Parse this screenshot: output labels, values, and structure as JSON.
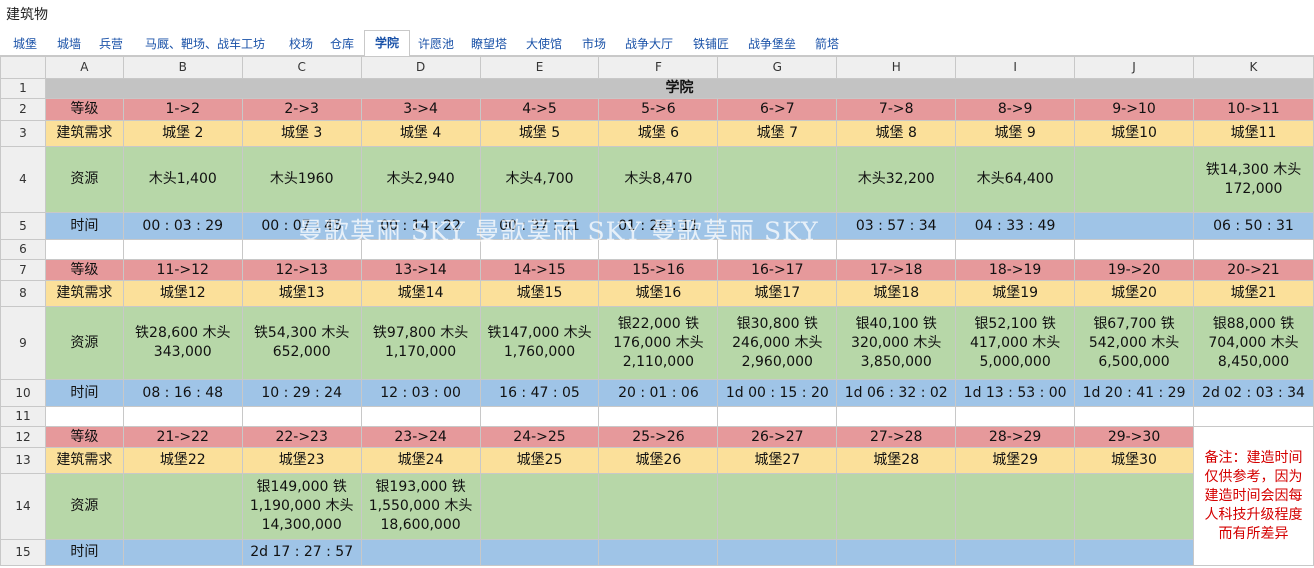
{
  "window": {
    "title": "建筑物"
  },
  "tabs": [
    {
      "label": "城堡"
    },
    {
      "label": "城墙"
    },
    {
      "label": "兵营"
    },
    {
      "label": "马厩、靶场、战车工坊"
    },
    {
      "label": "校场"
    },
    {
      "label": "仓库"
    },
    {
      "label": "学院",
      "active": true
    },
    {
      "label": "许愿池"
    },
    {
      "label": "瞭望塔"
    },
    {
      "label": "大使馆"
    },
    {
      "label": "市场"
    },
    {
      "label": "战争大厅"
    },
    {
      "label": "铁铺匠"
    },
    {
      "label": "战争堡垒"
    },
    {
      "label": "箭塔"
    }
  ],
  "columns": [
    "A",
    "B",
    "C",
    "D",
    "E",
    "F",
    "G",
    "H",
    "I",
    "J",
    "K"
  ],
  "row_numbers": [
    "1",
    "2",
    "3",
    "4",
    "5",
    "6",
    "7",
    "8",
    "9",
    "10",
    "11",
    "12",
    "13",
    "14",
    "15"
  ],
  "section_title": "学院",
  "labels": {
    "level": "等级",
    "requirement": "建筑需求",
    "resource": "资源",
    "time": "时间"
  },
  "block1": {
    "levels": [
      "1->2",
      "2->3",
      "3->4",
      "4->5",
      "5->6",
      "6->7",
      "7->8",
      "8->9",
      "9->10",
      "10->11"
    ],
    "requirements": [
      "城堡 2",
      "城堡 3",
      "城堡 4",
      "城堡 5",
      "城堡 6",
      "城堡 7",
      "城堡 8",
      "城堡 9",
      "城堡10",
      "城堡11"
    ],
    "resources": [
      "木头1,400",
      "木头1960",
      "木头2,940",
      "木头4,700",
      "木头8,470",
      "",
      "木头32,200",
      "木头64,400",
      "",
      "铁14,300 木头\n172,000"
    ],
    "times": [
      "00 : 03 : 29",
      "00 : 07 : 45",
      "00 : 14 : 22",
      "00 : 37 : 21",
      "01 : 26 : 11",
      "",
      "03 : 57 : 34",
      "04 : 33 : 49",
      "",
      "06 : 50 : 31"
    ]
  },
  "block2": {
    "levels": [
      "11->12",
      "12->13",
      "13->14",
      "14->15",
      "15->16",
      "16->17",
      "17->18",
      "18->19",
      "19->20",
      "20->21"
    ],
    "requirements": [
      "城堡12",
      "城堡13",
      "城堡14",
      "城堡15",
      "城堡16",
      "城堡17",
      "城堡18",
      "城堡19",
      "城堡20",
      "城堡21"
    ],
    "resources": [
      "铁28,600 木头\n343,000",
      "铁54,300 木头\n652,000",
      "铁97,800 木头\n1,170,000",
      "铁147,000 木头\n1,760,000",
      "银22,000 铁\n176,000 木头\n2,110,000",
      "银30,800 铁\n246,000 木头\n2,960,000",
      "银40,100 铁\n320,000 木头\n3,850,000",
      "银52,100 铁\n417,000 木头\n5,000,000",
      "银67,700 铁\n542,000 木头\n6,500,000",
      "银88,000 铁\n704,000 木头\n8,450,000"
    ],
    "times": [
      "08 : 16 : 48",
      "10 : 29 : 24",
      "12 : 03 : 00",
      "16 : 47 : 05",
      "20 : 01 : 06",
      "1d 00 : 15 : 20",
      "1d 06 : 32 : 02",
      "1d 13 : 53 : 00",
      "1d 20 : 41 : 29",
      "2d 02 : 03 : 34"
    ]
  },
  "block3": {
    "levels": [
      "21->22",
      "22->23",
      "23->24",
      "24->25",
      "25->26",
      "26->27",
      "27->28",
      "28->29",
      "29->30"
    ],
    "requirements": [
      "城堡22",
      "城堡23",
      "城堡24",
      "城堡25",
      "城堡26",
      "城堡27",
      "城堡28",
      "城堡29",
      "城堡30"
    ],
    "resources": [
      "",
      "银149,000 铁\n1,190,000 木头\n14,300,000",
      "银193,000 铁\n1,550,000 木头\n18,600,000",
      "",
      "",
      "",
      "",
      "",
      ""
    ],
    "times": [
      "",
      "2d 17 : 27 : 57",
      "",
      "",
      "",
      "",
      "",
      "",
      ""
    ]
  },
  "note": "备注：建造时间\n仅供参考，因为\n建造时间会因每\n人科技升级程度\n而有所差异",
  "watermark": "曼歌莫丽 SKY 曼歌莫丽 SKY 曼歌莫丽 SKY",
  "colors": {
    "level": "#e6999b",
    "requirement": "#fbe09a",
    "resource": "#b7d7a8",
    "time": "#9fc4e7",
    "section": "#c3c3c3",
    "note": "#d40000",
    "tab_link": "#1a52a8"
  }
}
